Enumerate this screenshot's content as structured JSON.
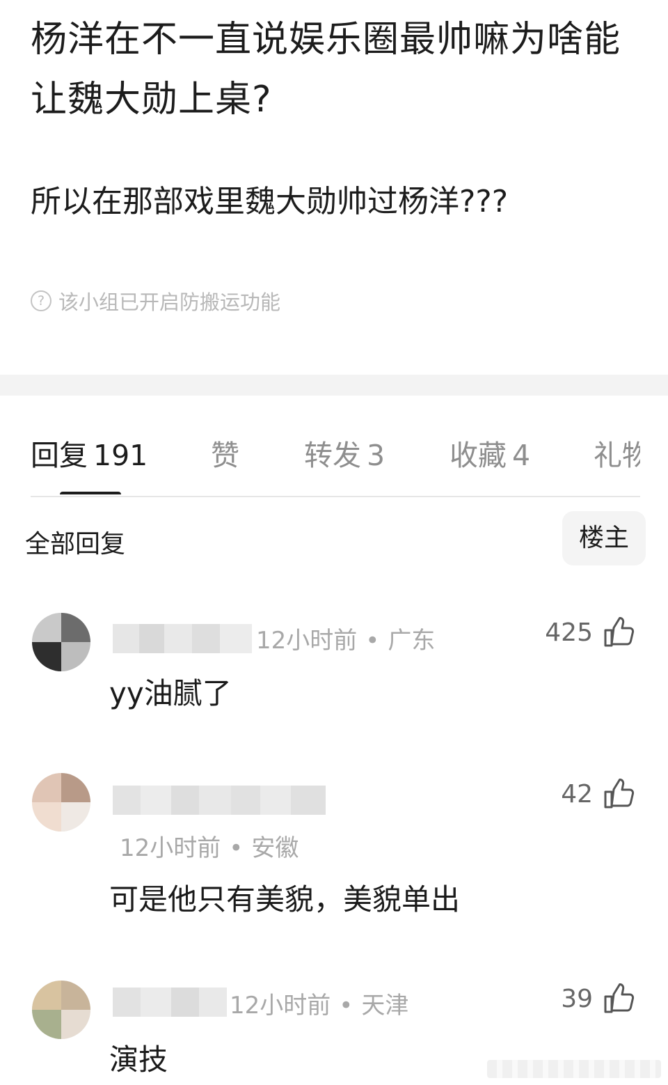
{
  "post": {
    "title": "杨洋在不一直说娱乐圈最帅嘛为啥能让魏大勋上桌?",
    "body": "所以在那部戏里魏大勋帅过杨洋???",
    "notice": "该小组已开启防搬运功能"
  },
  "tabs": [
    {
      "label": "回复",
      "count": "191"
    },
    {
      "label": "赞",
      "count": ""
    },
    {
      "label": "转发",
      "count": "3"
    },
    {
      "label": "收藏",
      "count": "4"
    },
    {
      "label": "礼物",
      "count": ""
    }
  ],
  "section": {
    "title": "全部回复",
    "filter_label": "楼主"
  },
  "comments": [
    {
      "time": "12小时前",
      "location": "广东",
      "text": "yy油腻了",
      "likes": "425"
    },
    {
      "time": "12小时前",
      "location": "安徽",
      "text": "可是他只有美貌，美貌单出",
      "likes": "42"
    },
    {
      "time": "12小时前",
      "location": "天津",
      "text": "演技",
      "likes": "39"
    }
  ],
  "colors": {
    "text_primary": "#1c1c1c",
    "text_secondary": "#a8a8a8",
    "tab_inactive": "#8e8e8e",
    "band": "#f3f3f3"
  }
}
